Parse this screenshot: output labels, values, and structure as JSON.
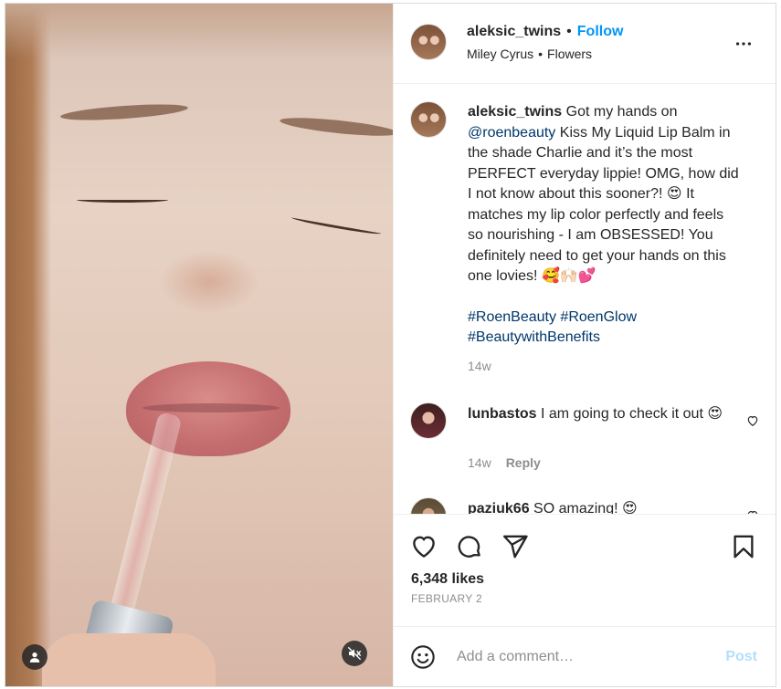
{
  "post": {
    "author": "aleksic_twins",
    "follow_label": "Follow",
    "separator": "•",
    "audio": {
      "artist": "Miley Cyrus",
      "separator": "•",
      "track": "Flowers"
    },
    "caption": {
      "author": "aleksic_twins",
      "text_part1": "Got my hands on",
      "mention": "@roenbeauty",
      "text_part2": "Kiss My Liquid Lip Balm in the shade Charlie and it’s the most PERFECT everyday lippie! OMG, how did I not know about this sooner?!",
      "emoji1": "😍",
      "text_part3": "It matches my lip color perfectly and feels so nourishing - I am OBSESSED! You definitely need to get your hands on this one lovies!",
      "emoji2": "🥰🙌🏻💕",
      "hashtags": [
        "#RoenBeauty",
        "#RoenGlow",
        "#BeautywithBenefits"
      ],
      "age": "14w"
    },
    "comments": [
      {
        "user": "lunbastos",
        "text": "I am going to check it out",
        "emoji": "😍",
        "age": "14w",
        "reply_label": "Reply"
      },
      {
        "user": "paziuk66",
        "text": "SO amazing!",
        "emoji": "😍"
      }
    ],
    "likes": "6,348 likes",
    "date": "FEBRUARY 2",
    "add_comment_placeholder": "Add a comment…",
    "post_label": "Post"
  },
  "colors": {
    "accent": "#0095f6",
    "link": "#00376b",
    "muted": "#8e8e8e",
    "text": "#262626",
    "post_disabled": "#b2dffc"
  },
  "icons": [
    "more-icon",
    "heart-icon",
    "comment-icon",
    "share-icon",
    "bookmark-icon",
    "emoji-icon",
    "user-tag-icon",
    "mute-icon"
  ]
}
